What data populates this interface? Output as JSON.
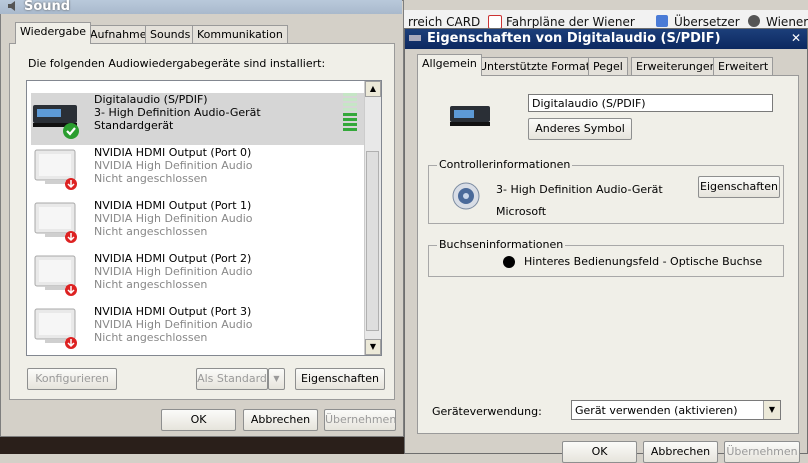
{
  "background": {
    "items": [
      "rreich CARD",
      "Fahrpläne der Wiener",
      "Übersetzer",
      "Wiener"
    ]
  },
  "sound_window": {
    "title": "Sound",
    "tabs": [
      {
        "label": "Wiedergabe",
        "active": true
      },
      {
        "label": "Aufnahme"
      },
      {
        "label": "Sounds"
      },
      {
        "label": "Kommunikation"
      }
    ],
    "intro": "Die folgenden Audiowiedergabegeräte sind installiert:",
    "devices": [
      {
        "name": "Digitalaudio (S/PDIF)",
        "driver": "3- High Definition Audio-Gerät",
        "status": "Standardgerät",
        "selected": true,
        "default": true
      },
      {
        "name": "NVIDIA HDMI Output (Port 0)",
        "driver": "NVIDIA High Definition Audio",
        "status": "Nicht angeschlossen"
      },
      {
        "name": "NVIDIA HDMI Output (Port 1)",
        "driver": "NVIDIA High Definition Audio",
        "status": "Nicht angeschlossen"
      },
      {
        "name": "NVIDIA HDMI Output (Port 2)",
        "driver": "NVIDIA High Definition Audio",
        "status": "Nicht angeschlossen"
      },
      {
        "name": "NVIDIA HDMI Output (Port 3)",
        "driver": "NVIDIA High Definition Audio",
        "status": "Nicht angeschlossen"
      }
    ],
    "buttons": {
      "configure": "Konfigurieren",
      "set_default": "Als Standard",
      "properties": "Eigenschaften",
      "ok": "OK",
      "cancel": "Abbrechen",
      "apply": "Übernehmen"
    }
  },
  "props_window": {
    "title": "Eigenschaften von Digitalaudio (S/PDIF)",
    "close_glyph": "✕",
    "tabs": [
      {
        "label": "Allgemein",
        "active": true
      },
      {
        "label": "Unterstützte Formate"
      },
      {
        "label": "Pegel"
      },
      {
        "label": "Erweiterungen"
      },
      {
        "label": "Erweitert"
      }
    ],
    "device_name_value": "Digitalaudio (S/PDIF)",
    "change_icon_button": "Anderes Symbol",
    "controller": {
      "group_label": "Controllerinformationen",
      "name": "3- High Definition Audio-Gerät",
      "vendor": "Microsoft",
      "properties_button": "Eigenschaften"
    },
    "jack": {
      "group_label": "Buchseninformationen",
      "text": "Hinteres Bedienungsfeld - Optische Buchse"
    },
    "usage": {
      "label": "Geräteverwendung:",
      "value": "Gerät verwenden (aktivieren)"
    },
    "buttons": {
      "ok": "OK",
      "cancel": "Abbrechen",
      "apply": "Übernehmen"
    }
  },
  "colors": {
    "selection": "#d6d6d6",
    "title_active": "#0c2860",
    "level_green": "#34a83a"
  }
}
